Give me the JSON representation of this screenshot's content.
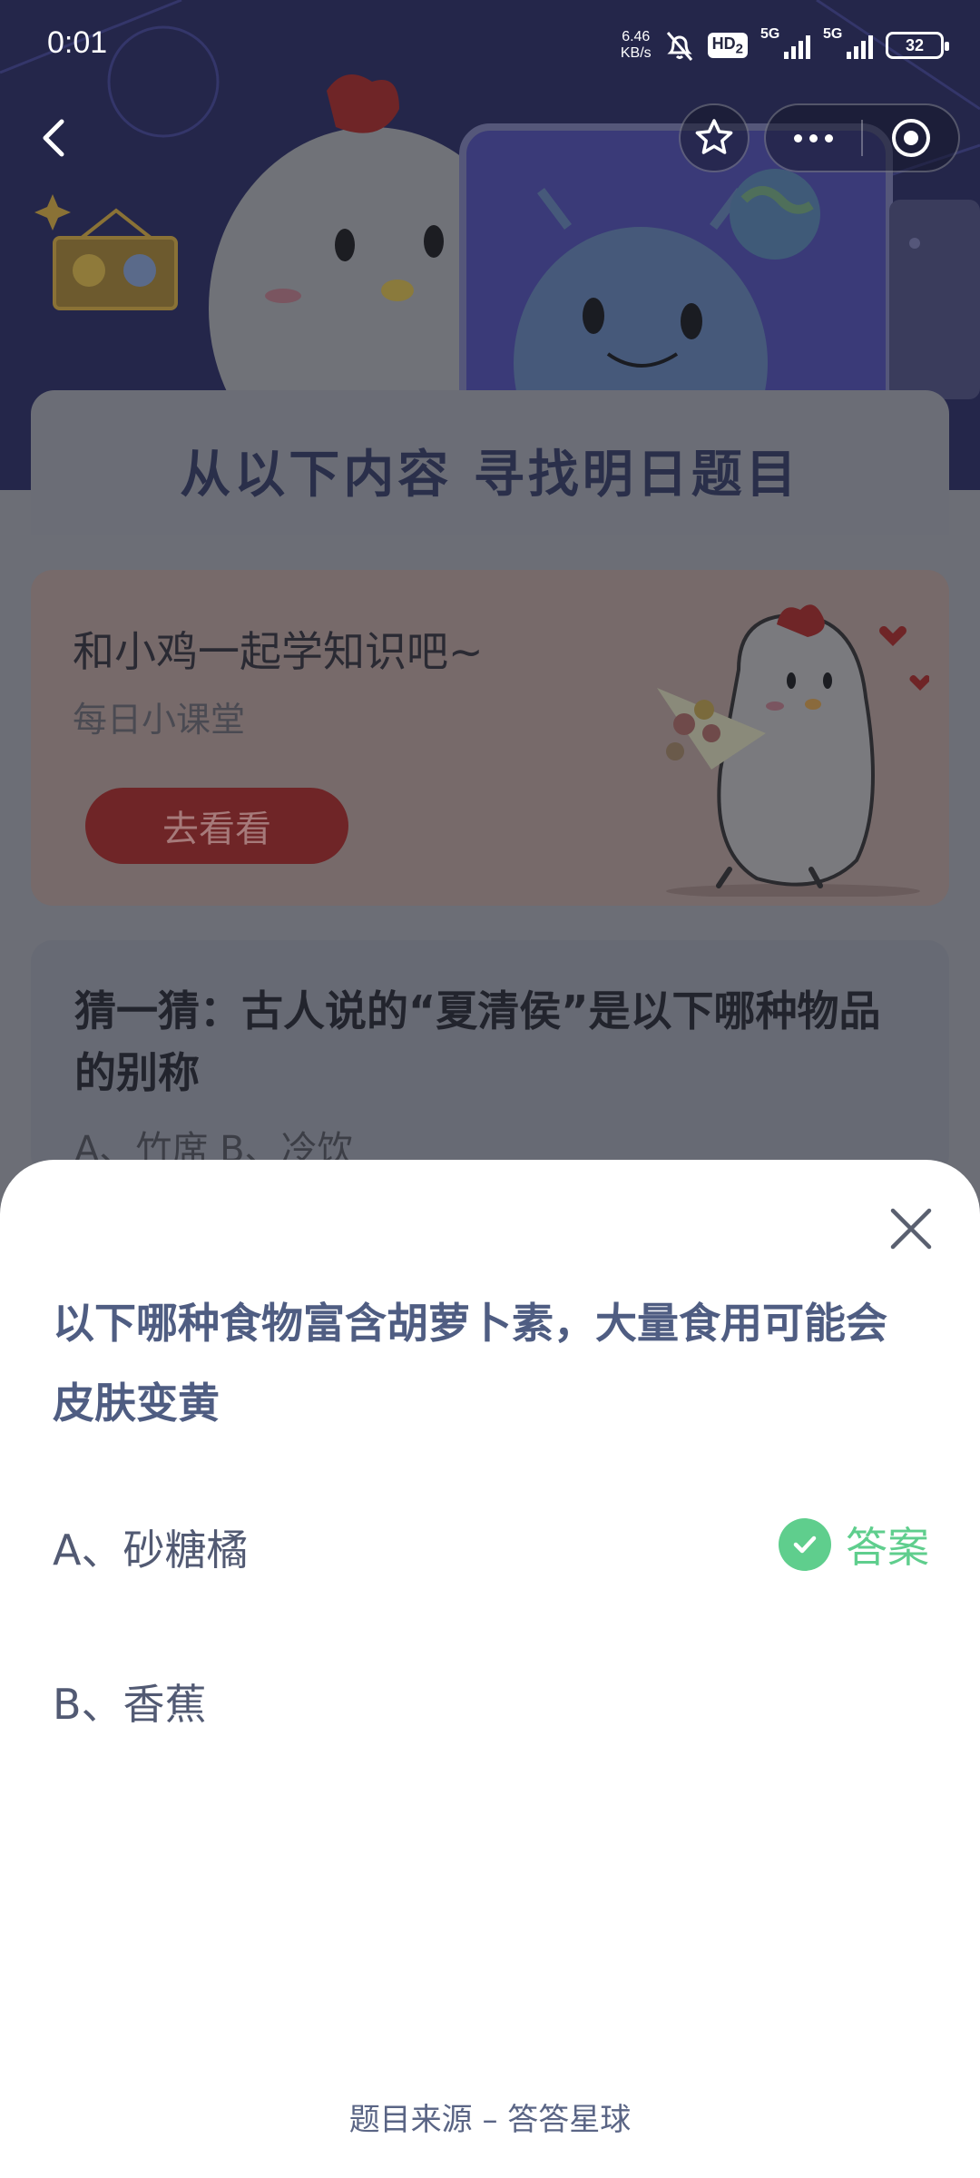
{
  "status_bar": {
    "time": "0:01",
    "net_speed_value": "6.46",
    "net_speed_unit": "KB/s",
    "hd_badge": "HD",
    "hd_sub": "2",
    "signal1_label": "5G",
    "signal2_label": "5G",
    "battery": "32"
  },
  "nav": {
    "icons": [
      "back-arrow",
      "star",
      "more-dots",
      "target"
    ]
  },
  "hero": {
    "title": "从以下内容  寻找明日题目"
  },
  "learn_card": {
    "title": "和小鸡一起学知识吧~",
    "subtitle": "每日小课堂",
    "button": "去看看"
  },
  "guess_card": {
    "question": "猜一猜：古人说的“夏清侯”是以下哪种物品的别称",
    "options_preview": "A、竹席    B、冷饮"
  },
  "sheet": {
    "question": "以下哪种食物富含胡萝卜素，大量食用可能会皮肤变黄",
    "options": [
      {
        "label": "A、砂糖橘",
        "is_answer": true
      },
      {
        "label": "B、香蕉",
        "is_answer": false
      }
    ],
    "answer_label": "答案",
    "source": "题目来源 – 答答星球"
  },
  "colors": {
    "answer_green": "#5fce8d",
    "question_text": "#4f5d82",
    "hero_bg": "#24264a",
    "button_red": "#6f2527"
  }
}
